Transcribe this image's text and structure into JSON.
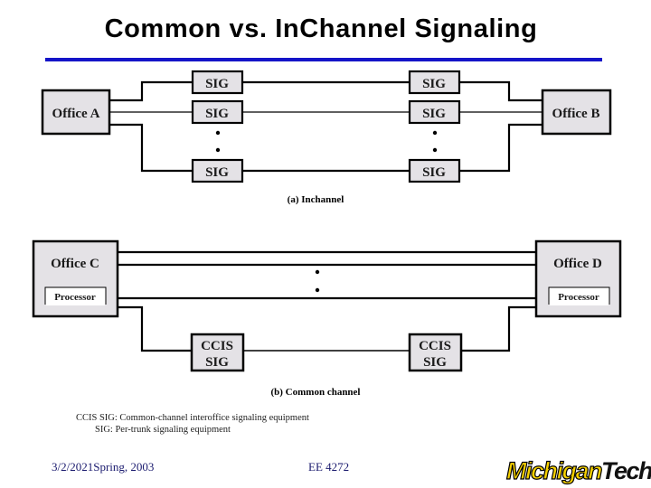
{
  "slide": {
    "title": "Common vs. InChannel Signaling",
    "accent_color": "#1414c8"
  },
  "diagram_a": {
    "caption": "(a) Inchannel",
    "office_left": "Office A",
    "office_right": "Office B",
    "sig_label": "SIG",
    "sig_rows": 3,
    "ellipsis": "• •"
  },
  "diagram_b": {
    "caption": "(b) Common channel",
    "office_left": "Office C",
    "office_right": "Office D",
    "processor_label": "Processor",
    "ccis_label_line1": "CCIS",
    "ccis_label_line2": "SIG",
    "trunk_lines": 3
  },
  "legend": {
    "line1": "CCIS SIG: Common-channel interoffice signaling equipment",
    "line2": "        SIG: Per-trunk signaling equipment"
  },
  "footer": {
    "date_term": "3/2/2021Spring, 2003",
    "course": "EE 4272",
    "logo_part1": "Michigan",
    "logo_part2": "Tech",
    "logo_color": "#f5d000"
  }
}
